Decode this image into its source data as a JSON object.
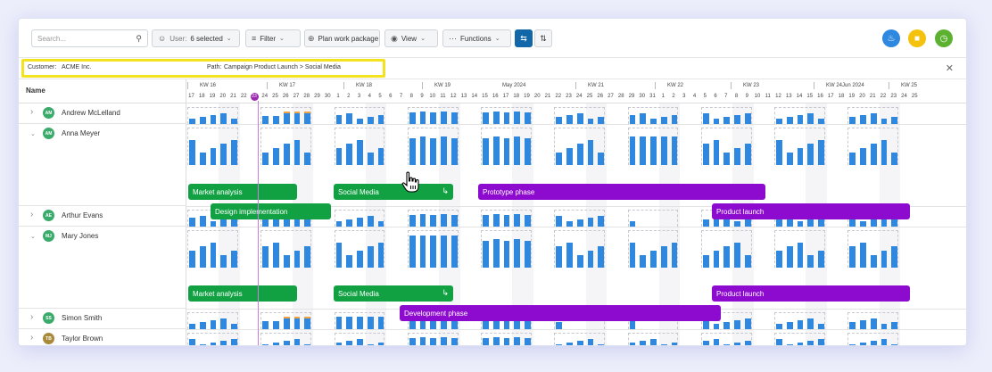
{
  "toolbar": {
    "search_placeholder": "Search...",
    "user_label": "User:",
    "user_value": "6 selected",
    "filter_label": "Filter",
    "plan_label": "Plan work package",
    "view_label": "View",
    "functions_label": "Functions",
    "colors": {
      "notify": "#2f88df",
      "chat": "#f4c20d",
      "time": "#5cb130",
      "toggle_active": "#1167a8"
    }
  },
  "infobar": {
    "customer_label": "Customer:",
    "customer_value": "ACME Inc.",
    "path_label": "Path:",
    "path_value": "Campaign Product Launch > Social Media"
  },
  "grid": {
    "name_header": "Name",
    "weeks": [
      "KW 16",
      "KW 17",
      "KW 18",
      "KW 19",
      "KW 21",
      "KW 22",
      "KW 23",
      "KW 24",
      "KW 25"
    ],
    "months": [
      "May 2024",
      "Jun 2024"
    ],
    "days": [
      "17",
      "18",
      "19",
      "20",
      "21",
      "22",
      "23",
      "24",
      "25",
      "26",
      "27",
      "28",
      "29",
      "30",
      "1",
      "2",
      "3",
      "4",
      "5",
      "6",
      "7",
      "8",
      "9",
      "10",
      "11",
      "12",
      "13",
      "14",
      "15",
      "16",
      "17",
      "18",
      "19",
      "20",
      "21",
      "22",
      "23",
      "24",
      "25",
      "26",
      "27",
      "28",
      "29",
      "30",
      "31",
      "1",
      "2",
      "3",
      "4",
      "5",
      "6",
      "7",
      "8",
      "9",
      "10",
      "11",
      "12",
      "13",
      "14",
      "15",
      "16",
      "17",
      "18",
      "19",
      "20",
      "21",
      "22",
      "23",
      "24",
      "25"
    ],
    "today_day": "23"
  },
  "people": [
    {
      "initials": "AM",
      "name": "Andrew McLelland",
      "color": "#3aab6b",
      "expanded": false
    },
    {
      "initials": "AM",
      "name": "Anna Meyer",
      "color": "#3aab6b",
      "expanded": true
    },
    {
      "initials": "AE",
      "name": "Arthur Evans",
      "color": "#3aab6b",
      "expanded": false
    },
    {
      "initials": "MJ",
      "name": "Mary Jones",
      "color": "#3aab6b",
      "expanded": true
    },
    {
      "initials": "SS",
      "name": "Simon Smith",
      "color": "#3aab6b",
      "expanded": false
    },
    {
      "initials": "TB",
      "name": "Taylor Brown",
      "color": "#a88a3a",
      "expanded": false
    }
  ],
  "tasks": {
    "anna": [
      {
        "label": "Market analysis",
        "color": "green"
      },
      {
        "label": "Social Media",
        "color": "green"
      },
      {
        "label": "Prototype phase",
        "color": "purple"
      },
      {
        "label": "Design implementation",
        "color": "green"
      },
      {
        "label": "Product launch",
        "color": "purple"
      }
    ],
    "mary": [
      {
        "label": "Market analysis",
        "color": "green"
      },
      {
        "label": "Social Media",
        "color": "green"
      },
      {
        "label": "Product launch",
        "color": "purple"
      },
      {
        "label": "Development phase",
        "color": "purple"
      }
    ]
  }
}
